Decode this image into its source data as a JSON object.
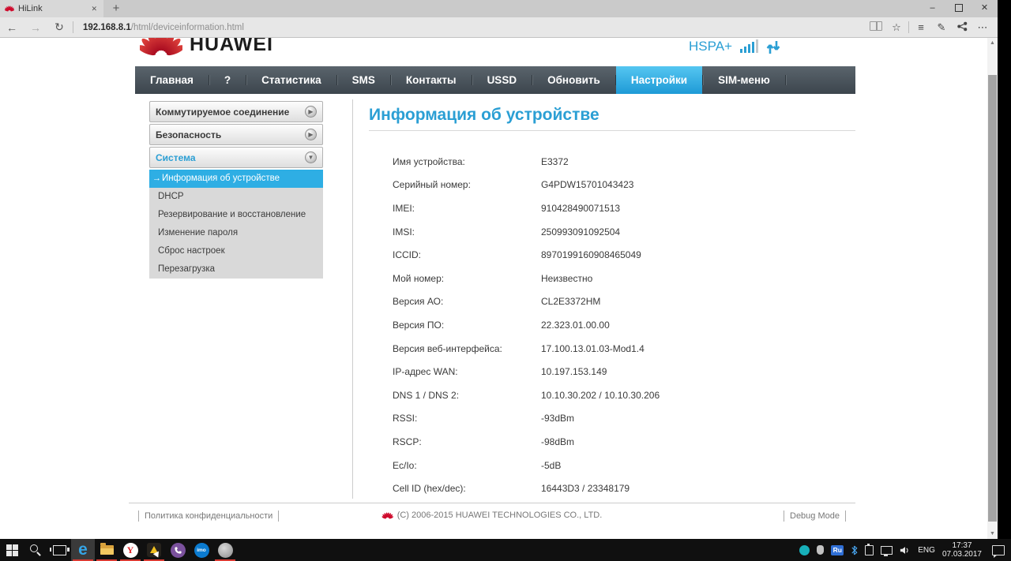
{
  "colors": {
    "accent_blue": "#2b9fd4",
    "nav_active_blue": "#2fa9dc",
    "huawei_red": "#cf0a2c",
    "running_indicator_red": "#d93a32"
  },
  "browser": {
    "tab_title": "HiLink",
    "url_host": "192.168.8.1",
    "url_path": "/html/deviceinformation.html"
  },
  "icons": {
    "back": "←",
    "forward": "→",
    "refresh": "↻",
    "star": "☆",
    "hub": "≡",
    "web_note": "✎",
    "more": "⋯",
    "minimize": "–",
    "close": "✕",
    "tab_close": "✕",
    "new_tab": "+",
    "scroll_up": "▲",
    "scroll_down": "▼",
    "chevron_right": "▶",
    "chevron_down": "▼",
    "active_item_arrow": "→"
  },
  "header": {
    "logo_text": "HUAWEI",
    "network_type": "HSPA+"
  },
  "nav": {
    "items": [
      {
        "label": "Главная"
      },
      {
        "label": "?"
      },
      {
        "label": "Статистика"
      },
      {
        "label": "SMS"
      },
      {
        "label": "Контакты"
      },
      {
        "label": "USSD"
      },
      {
        "label": "Обновить"
      },
      {
        "label": "Настройки",
        "active": true
      },
      {
        "label": "SIM-меню"
      }
    ]
  },
  "sidebar": {
    "sections": [
      {
        "label": "Коммутируемое соединение",
        "expanded": false
      },
      {
        "label": "Безопасность",
        "expanded": false
      },
      {
        "label": "Система",
        "expanded": true
      }
    ],
    "system_items": [
      {
        "label": "Информация об устройстве",
        "active": true
      },
      {
        "label": "DHCP"
      },
      {
        "label": "Резервирование и восстановление"
      },
      {
        "label": "Изменение пароля"
      },
      {
        "label": "Сброс настроек"
      },
      {
        "label": "Перезагрузка"
      }
    ]
  },
  "main": {
    "title": "Информация об устройстве",
    "rows": [
      {
        "label": "Имя устройства:",
        "value": "E3372"
      },
      {
        "label": "Серийный номер:",
        "value": "G4PDW15701043423"
      },
      {
        "label": "IMEI:",
        "value": "910428490071513"
      },
      {
        "label": "IMSI:",
        "value": "250993091092504"
      },
      {
        "label": "ICCID:",
        "value": "8970199160908465049"
      },
      {
        "label": "Мой номер:",
        "value": "Неизвестно"
      },
      {
        "label": "Версия АО:",
        "value": "CL2E3372HM"
      },
      {
        "label": "Версия ПО:",
        "value": "22.323.01.00.00"
      },
      {
        "label": "Версия веб-интерфейса:",
        "value": "17.100.13.01.03-Mod1.4"
      },
      {
        "label": "IP-адрес WAN:",
        "value": "10.197.153.149"
      },
      {
        "label": "DNS 1 / DNS 2:",
        "value": "10.10.30.202 / 10.10.30.206"
      },
      {
        "label": "RSSI:",
        "value": "-93dBm"
      },
      {
        "label": "RSCP:",
        "value": "-98dBm"
      },
      {
        "label": "Ec/Io:",
        "value": "-5dB"
      },
      {
        "label": "Cell ID (hex/dec):",
        "value": "16443D3 / 23348179"
      }
    ]
  },
  "footer": {
    "privacy": "Политика конфиденциальности",
    "copyright": "(C) 2006-2015 HUAWEI TECHNOLOGIES CO., LTD.",
    "debug": "Debug Mode"
  },
  "taskbar": {
    "edge_label": "e",
    "yandex_label": "Y",
    "imo_label": "imo",
    "ru_label": "Ru",
    "language": "ENG",
    "time": "17:37",
    "date": "07.03.2017"
  }
}
